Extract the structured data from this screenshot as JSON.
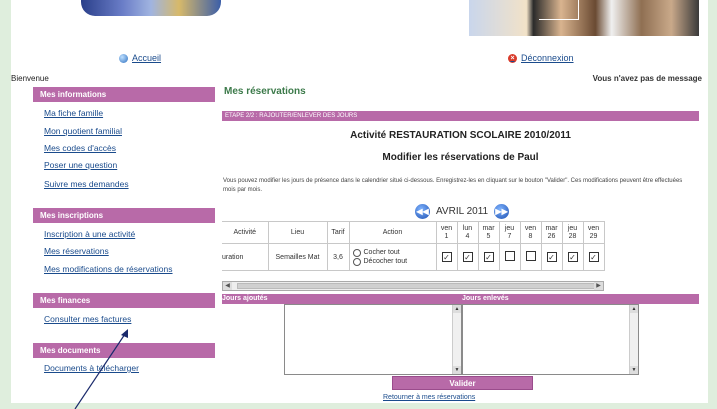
{
  "header": {
    "home_link": "Accueil",
    "logout_link": "Déconnexion",
    "welcome": "Bienvenue",
    "messages": "Vous n'avez pas de message"
  },
  "sidebar": {
    "sections": [
      {
        "title": "Mes informations",
        "items": [
          "Ma fiche famille",
          "Mon quotient familial",
          "Mes codes d'accès",
          "Poser une question",
          "Suivre mes demandes"
        ]
      },
      {
        "title": "Mes inscriptions",
        "items": [
          "Inscription à une activité",
          "Mes réservations",
          "Mes modifications de réservations"
        ]
      },
      {
        "title": "Mes finances",
        "items": [
          "Consulter mes factures"
        ]
      },
      {
        "title": "Mes documents",
        "items": [
          "Documents à télécharger"
        ]
      }
    ]
  },
  "main": {
    "title": "Mes réservations",
    "step": "ETAPE 2/2 : RAJOUTER/ENLEVER DES JOURS",
    "activity_title": "Activité RESTAURATION SCOLAIRE 2010/2011",
    "modify_title": "Modifier les réservations de Paul",
    "description": "Vous pouvez modifier les jours de présence dans le calendrier situé ci-dessous. Enregistrez-les en cliquant sur le bouton \"Valider\". Ces modifications peuvent être effectuées mois par mois.",
    "month_label": "AVRIL 2011",
    "table": {
      "headers": {
        "activity": "Activité",
        "place": "Lieu",
        "price": "Tarif",
        "action": "Action"
      },
      "days": [
        {
          "dow": "ven",
          "num": "1",
          "checked": true
        },
        {
          "dow": "lun",
          "num": "4",
          "checked": true
        },
        {
          "dow": "mar",
          "num": "5",
          "checked": true
        },
        {
          "dow": "jeu",
          "num": "7",
          "checked": false
        },
        {
          "dow": "ven",
          "num": "8",
          "checked": false
        },
        {
          "dow": "mar",
          "num": "26",
          "checked": true
        },
        {
          "dow": "jeu",
          "num": "28",
          "checked": true
        },
        {
          "dow": "ven",
          "num": "29",
          "checked": true
        }
      ],
      "row": {
        "activity": "uration",
        "place": "Semailles Mat",
        "price": "3,6"
      },
      "check_all": "Cocher tout",
      "uncheck_all": "Décocher tout"
    },
    "added_days_label": "Jours ajoutés",
    "removed_days_label": "Jours enlevés",
    "validate_button": "Valider",
    "back_link": "Retourner à mes réservations"
  },
  "colors": {
    "accent": "#b86aa8",
    "link": "#1a4b8c",
    "title_green": "#3c7a4a",
    "background": "#dfeedd"
  },
  "icons": [
    "home-icon",
    "logout-icon",
    "prev-month-icon",
    "next-month-icon"
  ]
}
